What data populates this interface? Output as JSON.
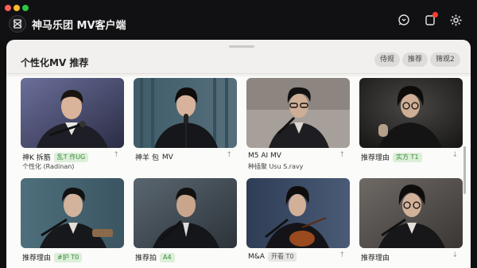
{
  "app": {
    "title": "神马乐团 MV客户端"
  },
  "toolbar": {
    "icons": [
      "chat-icon",
      "notification-icon",
      "gear-icon"
    ],
    "notification_color": "#ff3b30"
  },
  "section": {
    "title": "个性化MV  推荐",
    "chips": [
      "侍规",
      "推荐",
      "筛观2"
    ]
  },
  "cards": [
    {
      "label": "神K 拆筋",
      "tag": "乱T 作UG",
      "sub": "个性化 (Radinan)"
    },
    {
      "label": "神羊 包",
      "tag": "MV",
      "sub": ""
    },
    {
      "label": "M5 AI MV",
      "tag": "",
      "sub": "种插聚  Usu S.ravy"
    },
    {
      "label": "推荐理由",
      "tag": "实方 T1",
      "sub": ""
    },
    {
      "label": "推荐理由",
      "tag": "#护 T0",
      "sub": ""
    },
    {
      "label": "推荐拍",
      "tag": "A4",
      "sub": ""
    },
    {
      "label": "M&A",
      "tag": "开看 T0",
      "sub": ""
    },
    {
      "label": "推荐理由",
      "tag": "",
      "sub": ""
    }
  ]
}
